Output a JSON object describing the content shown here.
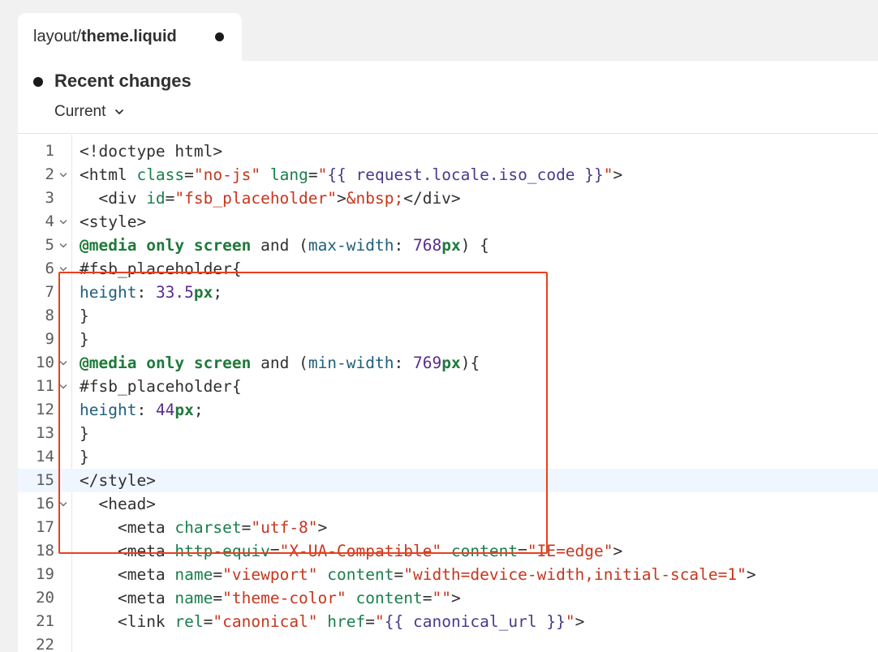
{
  "tab": {
    "dir": "layout/",
    "file": "theme.liquid",
    "unsaved_indicator": true
  },
  "changes": {
    "title": "Recent changes",
    "version_label": "Current"
  },
  "editor": {
    "active_line": 15,
    "lines": [
      {
        "n": "1",
        "fold": false,
        "indent": "",
        "tokens": [
          [
            "t-tag",
            "<!doctype html>"
          ]
        ]
      },
      {
        "n": "2",
        "fold": true,
        "indent": "",
        "tokens": [
          [
            "t-tag",
            "<html "
          ],
          [
            "t-attr",
            "class"
          ],
          [
            "t-tag",
            "="
          ],
          [
            "t-str",
            "\"no-js\""
          ],
          [
            "t-tag",
            " "
          ],
          [
            "t-attr",
            "lang"
          ],
          [
            "t-tag",
            "="
          ],
          [
            "t-str",
            "\""
          ],
          [
            "t-liq",
            "{{ request.locale.iso_code }}"
          ],
          [
            "t-str",
            "\""
          ],
          [
            "t-tag",
            ">"
          ]
        ]
      },
      {
        "n": "3",
        "fold": false,
        "indent": "  ",
        "tokens": [
          [
            "t-tag",
            "<div "
          ],
          [
            "t-attr",
            "id"
          ],
          [
            "t-tag",
            "="
          ],
          [
            "t-str",
            "\"fsb_placeholder\""
          ],
          [
            "t-tag",
            ">"
          ],
          [
            "t-str",
            "&nbsp;"
          ],
          [
            "t-tag",
            "</div>"
          ]
        ]
      },
      {
        "n": "4",
        "fold": true,
        "indent": "",
        "tokens": [
          [
            "t-tag",
            "<style>"
          ]
        ]
      },
      {
        "n": "5",
        "fold": true,
        "indent": "",
        "tokens": [
          [
            "t-kw",
            "@media"
          ],
          [
            "t-tag",
            " "
          ],
          [
            "t-kw",
            "only"
          ],
          [
            "t-tag",
            " "
          ],
          [
            "t-kw",
            "screen"
          ],
          [
            "t-tag",
            " and ("
          ],
          [
            "t-prop",
            "max-width"
          ],
          [
            "t-tag",
            ": "
          ],
          [
            "t-num",
            "768"
          ],
          [
            "t-unit",
            "px"
          ],
          [
            "t-tag",
            ") {"
          ]
        ]
      },
      {
        "n": "6",
        "fold": true,
        "indent": "",
        "tokens": [
          [
            "t-tag",
            "#fsb_placeholder{"
          ]
        ]
      },
      {
        "n": "7",
        "fold": false,
        "indent": "",
        "tokens": [
          [
            "t-prop",
            "height"
          ],
          [
            "t-tag",
            ": "
          ],
          [
            "t-num",
            "33.5"
          ],
          [
            "t-unit",
            "px"
          ],
          [
            "t-tag",
            ";"
          ]
        ]
      },
      {
        "n": "8",
        "fold": false,
        "indent": "",
        "tokens": [
          [
            "t-tag",
            "}"
          ]
        ]
      },
      {
        "n": "9",
        "fold": false,
        "indent": "",
        "tokens": [
          [
            "t-tag",
            "}"
          ]
        ]
      },
      {
        "n": "10",
        "fold": true,
        "indent": "",
        "tokens": [
          [
            "t-kw",
            "@media"
          ],
          [
            "t-tag",
            " "
          ],
          [
            "t-kw",
            "only"
          ],
          [
            "t-tag",
            " "
          ],
          [
            "t-kw",
            "screen"
          ],
          [
            "t-tag",
            " and ("
          ],
          [
            "t-prop",
            "min-width"
          ],
          [
            "t-tag",
            ": "
          ],
          [
            "t-num",
            "769"
          ],
          [
            "t-unit",
            "px"
          ],
          [
            "t-tag",
            "){"
          ]
        ]
      },
      {
        "n": "11",
        "fold": true,
        "indent": "",
        "tokens": [
          [
            "t-tag",
            "#fsb_placeholder{"
          ]
        ]
      },
      {
        "n": "12",
        "fold": false,
        "indent": "",
        "tokens": [
          [
            "t-prop",
            "height"
          ],
          [
            "t-tag",
            ": "
          ],
          [
            "t-num",
            "44"
          ],
          [
            "t-unit",
            "px"
          ],
          [
            "t-tag",
            ";"
          ]
        ]
      },
      {
        "n": "13",
        "fold": false,
        "indent": "",
        "tokens": [
          [
            "t-tag",
            "}"
          ]
        ]
      },
      {
        "n": "14",
        "fold": false,
        "indent": "",
        "tokens": [
          [
            "t-tag",
            "}"
          ]
        ]
      },
      {
        "n": "15",
        "fold": false,
        "indent": "",
        "tokens": [
          [
            "t-tag",
            "</style>"
          ]
        ]
      },
      {
        "n": "16",
        "fold": true,
        "indent": "  ",
        "tokens": [
          [
            "t-tag",
            "<head>"
          ]
        ]
      },
      {
        "n": "17",
        "fold": false,
        "indent": "    ",
        "tokens": [
          [
            "t-tag",
            "<meta "
          ],
          [
            "t-attr",
            "charset"
          ],
          [
            "t-tag",
            "="
          ],
          [
            "t-str",
            "\"utf-8\""
          ],
          [
            "t-tag",
            ">"
          ]
        ]
      },
      {
        "n": "18",
        "fold": false,
        "indent": "    ",
        "tokens": [
          [
            "t-tag",
            "<meta "
          ],
          [
            "t-attr",
            "http-equiv"
          ],
          [
            "t-tag",
            "="
          ],
          [
            "t-str",
            "\"X-UA-Compatible\""
          ],
          [
            "t-tag",
            " "
          ],
          [
            "t-attr",
            "content"
          ],
          [
            "t-tag",
            "="
          ],
          [
            "t-str",
            "\"IE=edge\""
          ],
          [
            "t-tag",
            ">"
          ]
        ]
      },
      {
        "n": "19",
        "fold": false,
        "indent": "    ",
        "tokens": [
          [
            "t-tag",
            "<meta "
          ],
          [
            "t-attr",
            "name"
          ],
          [
            "t-tag",
            "="
          ],
          [
            "t-str",
            "\"viewport\""
          ],
          [
            "t-tag",
            " "
          ],
          [
            "t-attr",
            "content"
          ],
          [
            "t-tag",
            "="
          ],
          [
            "t-str",
            "\"width=device-width,initial-scale=1\""
          ],
          [
            "t-tag",
            ">"
          ]
        ]
      },
      {
        "n": "20",
        "fold": false,
        "indent": "    ",
        "tokens": [
          [
            "t-tag",
            "<meta "
          ],
          [
            "t-attr",
            "name"
          ],
          [
            "t-tag",
            "="
          ],
          [
            "t-str",
            "\"theme-color\""
          ],
          [
            "t-tag",
            " "
          ],
          [
            "t-attr",
            "content"
          ],
          [
            "t-tag",
            "="
          ],
          [
            "t-str",
            "\"\""
          ],
          [
            "t-tag",
            ">"
          ]
        ]
      },
      {
        "n": "21",
        "fold": false,
        "indent": "    ",
        "tokens": [
          [
            "t-tag",
            "<link "
          ],
          [
            "t-attr",
            "rel"
          ],
          [
            "t-tag",
            "="
          ],
          [
            "t-str",
            "\"canonical\""
          ],
          [
            "t-tag",
            " "
          ],
          [
            "t-attr",
            "href"
          ],
          [
            "t-tag",
            "="
          ],
          [
            "t-str",
            "\""
          ],
          [
            "t-liq",
            "{{ canonical_url }}"
          ],
          [
            "t-str",
            "\""
          ],
          [
            "t-tag",
            ">"
          ]
        ]
      },
      {
        "n": "22",
        "fold": false,
        "indent": "",
        "tokens": []
      }
    ]
  },
  "colors": {
    "highlight_border": "#e8401c",
    "active_line_bg": "#f0f6ff"
  }
}
